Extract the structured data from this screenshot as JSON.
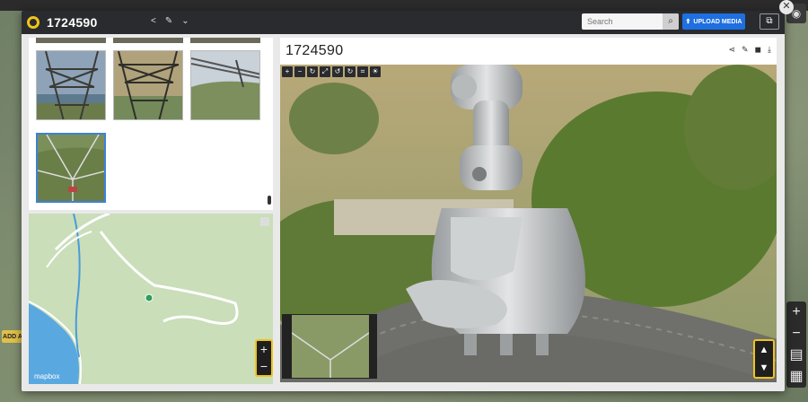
{
  "app": {
    "title": "1724590",
    "background_left_button": "ADD A",
    "close_symbol": "✕"
  },
  "header": {
    "search_placeholder": "Search",
    "upload_label": "UPLOAD MEDIA",
    "share_icon": "share-icon",
    "edit_icon": "pencil-icon",
    "dropdown_icon": "chevron-down-icon"
  },
  "viewer": {
    "title": "1724590",
    "actions": [
      "share-icon",
      "pencil-icon",
      "comment-icon",
      "download-icon"
    ],
    "toolbar": [
      "zoom-in",
      "zoom-out",
      "reset",
      "fit",
      "rotate-left",
      "rotate-right",
      "crop",
      "brightness"
    ]
  },
  "map": {
    "attribution": "mapbox",
    "zoom_in": "+",
    "zoom_out": "−"
  },
  "bg_controls": {
    "zoom_in": "+",
    "zoom_out": "−"
  },
  "colors": {
    "accent": "#f0c419",
    "upload": "#1e6fe0",
    "header": "#2a2b2e",
    "selected": "#3d82d6"
  }
}
